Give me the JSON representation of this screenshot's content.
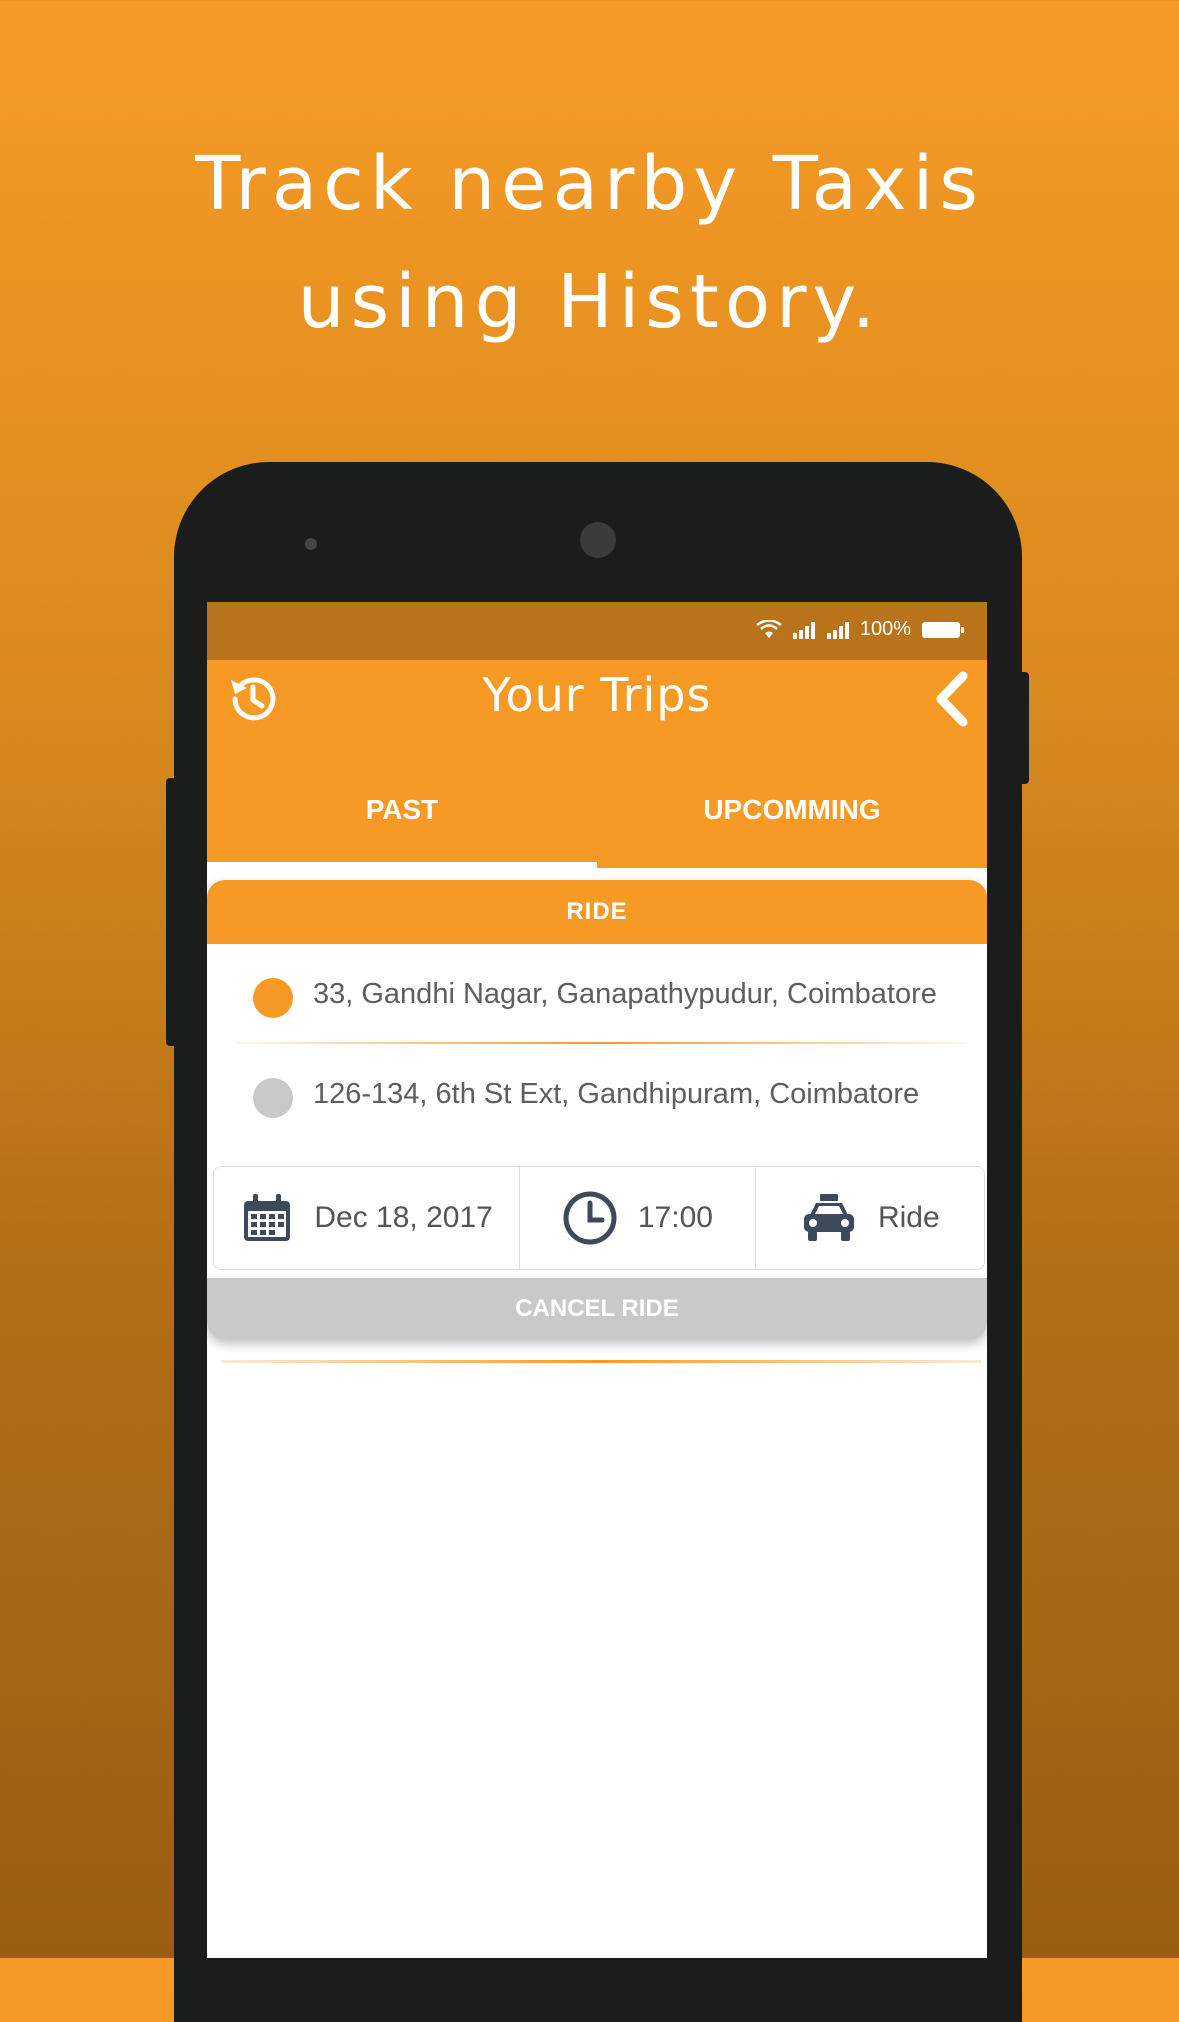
{
  "headline": {
    "line1": "Track nearby Taxis",
    "line2": "using History."
  },
  "status_bar": {
    "battery_text": "100%"
  },
  "app_bar": {
    "title": "Your Trips"
  },
  "tabs": [
    {
      "label": "PAST",
      "active": true
    },
    {
      "label": "UPCOMMING",
      "active": false
    }
  ],
  "ride_card": {
    "header": "RIDE",
    "pickup_address": "33, Gandhi Nagar, Ganapathypudur, Coimbatore",
    "drop_address": "126-134, 6th St Ext, Gandhipuram, Coimbatore",
    "date": "Dec 18, 2017",
    "time": "17:00",
    "ride_type": "Ride",
    "cancel_label": "CANCEL RIDE"
  },
  "colors": {
    "brand_orange": "#f79a25",
    "status_bar": "#b8731b",
    "pickup_dot": "#f79a25",
    "drop_dot": "#c9c9c9",
    "cancel_button": "#c9c9c9",
    "icon_slate": "#3e4a5c"
  },
  "icons": [
    "history-icon",
    "back-chevron-icon",
    "wifi-icon",
    "signal-icon",
    "battery-icon",
    "calendar-icon",
    "clock-icon",
    "taxi-icon"
  ]
}
